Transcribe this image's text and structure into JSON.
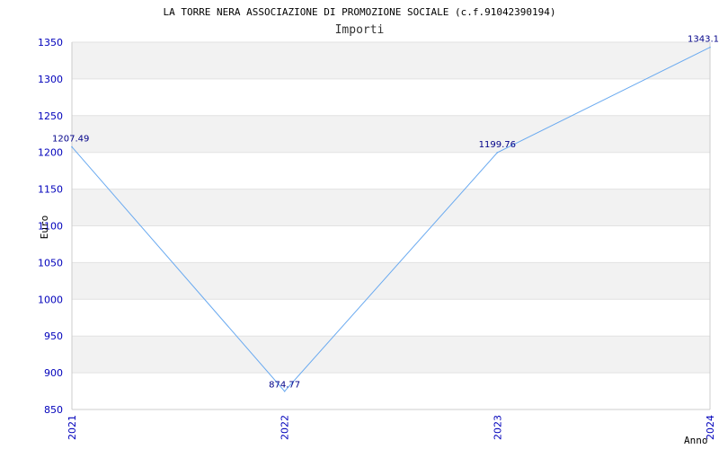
{
  "chart_data": {
    "type": "line",
    "title": "LA TORRE NERA ASSOCIAZIONE DI PROMOZIONE SOCIALE (c.f.91042390194)",
    "subtitle": "Importi",
    "xlabel": "Anno",
    "ylabel": "Euro",
    "categories": [
      "2021",
      "2022",
      "2023",
      "2024"
    ],
    "series": [
      {
        "values": [
          1207.49,
          874.77,
          1199.76,
          1343.1
        ]
      }
    ],
    "data_labels": [
      "1207.49",
      "874.77",
      "1199.76",
      "1343.1"
    ],
    "ylim": [
      850,
      1350
    ],
    "yticks": [
      850,
      900,
      950,
      1000,
      1050,
      1100,
      1150,
      1200,
      1250,
      1300,
      1350
    ],
    "grid": "horizontal bands",
    "colors": {
      "line": "#6aaaf0",
      "band": "#f2f2f2",
      "tick": "#0000bb",
      "data_label": "#000088"
    }
  }
}
